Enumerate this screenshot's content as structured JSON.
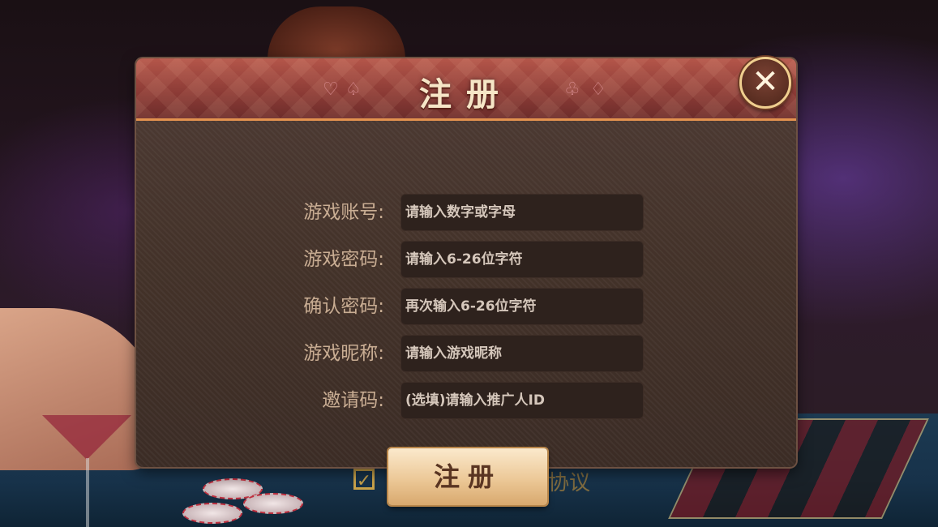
{
  "dialog": {
    "title": "注册",
    "suits_left": [
      "♡",
      "♤"
    ],
    "suits_right": [
      "♧",
      "♢"
    ],
    "close_label": "✕"
  },
  "form": {
    "fields": [
      {
        "label": "游戏账号:",
        "placeholder": "请输入数字或字母"
      },
      {
        "label": "游戏密码:",
        "placeholder": "请输入6-26位字符"
      },
      {
        "label": "确认密码:",
        "placeholder": "再次输入6-26位字符"
      },
      {
        "label": "游戏昵称:",
        "placeholder": "请输入游戏昵称"
      },
      {
        "label": "邀请码:",
        "placeholder": "(选填)请输入推广人ID"
      }
    ],
    "submit_label": "注册"
  },
  "background": {
    "checkbox_mark": "✓",
    "agreement_fragment": "协议"
  },
  "colors": {
    "header_red": "#8a3a35",
    "panel_brown": "#433229",
    "accent_gold": "#f0cf8f",
    "label_tan": "#c9ad93"
  }
}
